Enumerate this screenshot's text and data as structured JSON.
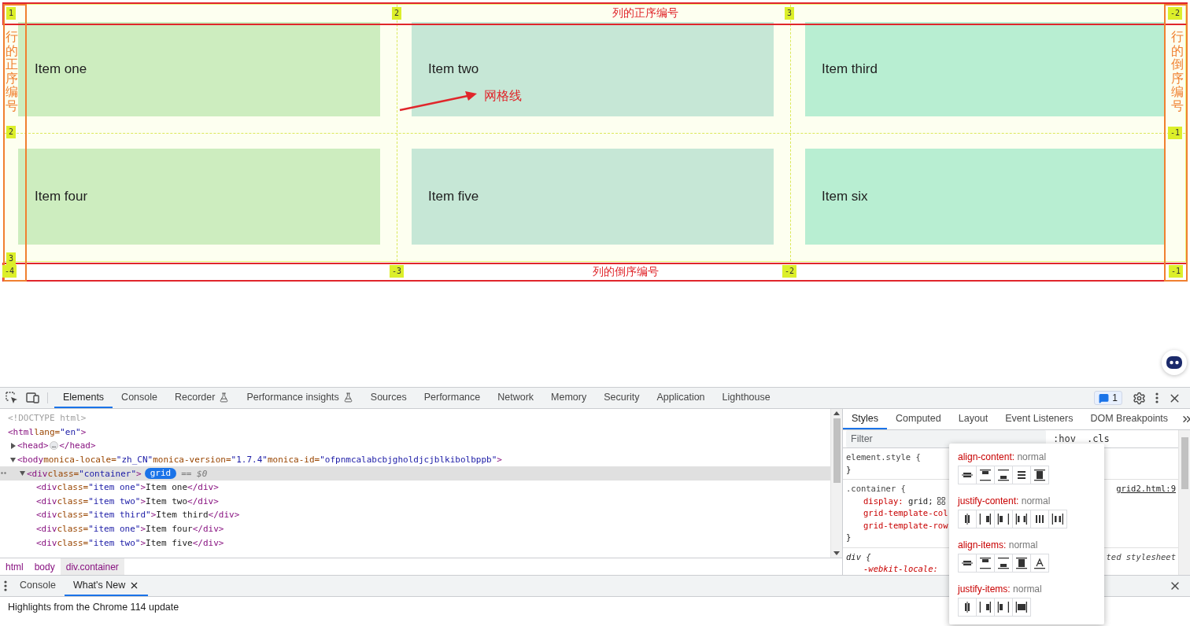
{
  "grid_demo": {
    "items": [
      {
        "label": "Item one",
        "color": "#cdedbf"
      },
      {
        "label": "Item two",
        "color": "#c6e7d6"
      },
      {
        "label": "Item third",
        "color": "#b8eed2"
      },
      {
        "label": "Item four",
        "color": "#cdedbf"
      },
      {
        "label": "Item five",
        "color": "#c6e7d6"
      },
      {
        "label": "Item six",
        "color": "#b8eed2"
      }
    ],
    "top_line_numbers": [
      "1",
      "2",
      "3",
      "-2"
    ],
    "left_line_numbers": [
      "2",
      "3"
    ],
    "right_line_numbers": [
      "-1"
    ],
    "bottom_line_numbers": [
      "-4",
      "-3",
      "-2",
      "-1"
    ],
    "labels": {
      "column_forward": "列的正序编号",
      "column_reverse": "列的倒序编号",
      "row_forward": "行的正序编号",
      "row_reverse": "行的倒序编号",
      "grid_line": "网格线"
    }
  },
  "devtools": {
    "toolbar_tabs": [
      {
        "label": "Elements",
        "selected": true
      },
      {
        "label": "Console",
        "selected": false
      },
      {
        "label": "Recorder",
        "selected": false,
        "experimental": true
      },
      {
        "label": "Performance insights",
        "selected": false,
        "experimental": true
      },
      {
        "label": "Sources",
        "selected": false
      },
      {
        "label": "Performance",
        "selected": false
      },
      {
        "label": "Network",
        "selected": false
      },
      {
        "label": "Memory",
        "selected": false
      },
      {
        "label": "Security",
        "selected": false
      },
      {
        "label": "Application",
        "selected": false
      },
      {
        "label": "Lighthouse",
        "selected": false
      }
    ],
    "issues_count": "1",
    "dom_tree": [
      {
        "segments": [
          {
            "kind": "doctype",
            "text": "<!DOCTYPE html>"
          }
        ],
        "selected": false
      },
      {
        "segments": [
          {
            "kind": "tag",
            "text": "<html"
          },
          {
            "kind": "attr",
            "text": " lang="
          },
          {
            "kind": "value",
            "text": "\"en\""
          },
          {
            "kind": "tag",
            "text": ">"
          }
        ],
        "selected": false,
        "children": [
          {
            "segments": [
              {
                "kind": "tag",
                "text": "<head>"
              },
              {
                "kind": "more",
                "text": "…"
              },
              {
                "kind": "tag",
                "text": "</head>"
              }
            ],
            "expanded": false,
            "selected": false
          },
          {
            "segments": [
              {
                "kind": "tag",
                "text": "<body"
              },
              {
                "kind": "attr",
                "text": " monica-locale="
              },
              {
                "kind": "value",
                "text": "\"zh_CN\""
              },
              {
                "kind": "attr",
                "text": " monica-version="
              },
              {
                "kind": "value",
                "text": "\"1.7.4\""
              },
              {
                "kind": "attr",
                "text": " monica-id="
              },
              {
                "kind": "value",
                "text": "\"ofpnmcalabcbjgholdjcjblkibolbppb\""
              },
              {
                "kind": "tag",
                "text": ">"
              }
            ],
            "expanded": true,
            "selected": false,
            "children": [
              {
                "segments": [
                  {
                    "kind": "tag",
                    "text": "<div"
                  },
                  {
                    "kind": "attr",
                    "text": " class="
                  },
                  {
                    "kind": "value",
                    "text": "\"container\""
                  },
                  {
                    "kind": "tag",
                    "text": ">"
                  },
                  {
                    "kind": "badge",
                    "text": "grid"
                  },
                  {
                    "kind": "ref",
                    "text": "== $0"
                  }
                ],
                "expanded": true,
                "selected": true,
                "children": [
                  {
                    "segments": [
                      {
                        "kind": "tag",
                        "text": "<div"
                      },
                      {
                        "kind": "attr",
                        "text": " class="
                      },
                      {
                        "kind": "value",
                        "text": "\"item one\""
                      },
                      {
                        "kind": "tag",
                        "text": ">"
                      },
                      {
                        "kind": "text",
                        "text": "Item one"
                      },
                      {
                        "kind": "tag",
                        "text": "</div>"
                      }
                    ],
                    "selected": false
                  },
                  {
                    "segments": [
                      {
                        "kind": "tag",
                        "text": "<div"
                      },
                      {
                        "kind": "attr",
                        "text": " class="
                      },
                      {
                        "kind": "value",
                        "text": "\"item two\""
                      },
                      {
                        "kind": "tag",
                        "text": ">"
                      },
                      {
                        "kind": "text",
                        "text": "Item two"
                      },
                      {
                        "kind": "tag",
                        "text": "</div>"
                      }
                    ],
                    "selected": false
                  },
                  {
                    "segments": [
                      {
                        "kind": "tag",
                        "text": "<div"
                      },
                      {
                        "kind": "attr",
                        "text": " class="
                      },
                      {
                        "kind": "value",
                        "text": "\"item third\""
                      },
                      {
                        "kind": "tag",
                        "text": ">"
                      },
                      {
                        "kind": "text",
                        "text": "Item third"
                      },
                      {
                        "kind": "tag",
                        "text": "</div>"
                      }
                    ],
                    "selected": false
                  },
                  {
                    "segments": [
                      {
                        "kind": "tag",
                        "text": "<div"
                      },
                      {
                        "kind": "attr",
                        "text": " class="
                      },
                      {
                        "kind": "value",
                        "text": "\"item one\""
                      },
                      {
                        "kind": "tag",
                        "text": ">"
                      },
                      {
                        "kind": "text",
                        "text": "Item four"
                      },
                      {
                        "kind": "tag",
                        "text": "</div>"
                      }
                    ],
                    "selected": false
                  },
                  {
                    "segments": [
                      {
                        "kind": "tag",
                        "text": "<div"
                      },
                      {
                        "kind": "attr",
                        "text": " class="
                      },
                      {
                        "kind": "value",
                        "text": "\"item two\""
                      },
                      {
                        "kind": "tag",
                        "text": ">"
                      },
                      {
                        "kind": "text",
                        "text": "Item five"
                      },
                      {
                        "kind": "tag",
                        "text": "</div>"
                      }
                    ],
                    "selected": false
                  }
                ]
              }
            ]
          }
        ]
      }
    ],
    "breadcrumbs": [
      {
        "label": "html",
        "selected": false
      },
      {
        "label": "body",
        "selected": false
      },
      {
        "label": "div.container",
        "selected": true
      }
    ],
    "sidebar_tabs": [
      {
        "label": "Styles",
        "selected": true
      },
      {
        "label": "Computed",
        "selected": false
      },
      {
        "label": "Layout",
        "selected": false
      },
      {
        "label": "Event Listeners",
        "selected": false
      },
      {
        "label": "DOM Breakpoints",
        "selected": false
      }
    ],
    "filter": {
      "placeholder": "Filter"
    },
    "filter_buttons": [
      ":hov",
      ".cls"
    ],
    "rules": [
      {
        "selector": "element.style",
        "open": "{",
        "close": "}"
      },
      {
        "selector": ".container",
        "open": "{",
        "close": "}",
        "source": "grid2.html:9",
        "declarations": [
          {
            "property": "display:",
            "value": "grid;",
            "grid_editor": true
          },
          {
            "property": "grid-template-col"
          },
          {
            "property": "grid-template-row"
          }
        ]
      },
      {
        "selector": "div",
        "open": "{",
        "user_agent": true,
        "source": "ted stylesheet",
        "declarations": [
          {
            "property": "-webkit-locale:"
          }
        ]
      }
    ],
    "grid_editor": [
      {
        "property": "align-content:",
        "value": "normal",
        "kind": "block",
        "options": [
          {
            "kind": "center"
          },
          {
            "kind": "start"
          },
          {
            "kind": "end"
          },
          {
            "kind": "space-around"
          },
          {
            "kind": "stretch"
          }
        ]
      },
      {
        "property": "justify-content:",
        "value": "normal",
        "kind": "inline",
        "options": [
          {
            "kind": "center"
          },
          {
            "kind": "start"
          },
          {
            "kind": "end"
          },
          {
            "kind": "space-between"
          },
          {
            "kind": "space-around"
          },
          {
            "kind": "space-evenly"
          }
        ]
      },
      {
        "property": "align-items:",
        "value": "normal",
        "kind": "block",
        "options": [
          {
            "kind": "center"
          },
          {
            "kind": "start"
          },
          {
            "kind": "end"
          },
          {
            "kind": "stretch"
          },
          {
            "kind": "baseline"
          }
        ]
      },
      {
        "property": "justify-items:",
        "value": "normal",
        "kind": "inline",
        "options": [
          {
            "kind": "center"
          },
          {
            "kind": "start"
          },
          {
            "kind": "end"
          },
          {
            "kind": "stretch"
          }
        ]
      }
    ],
    "drawer_tabs": [
      {
        "label": "Console",
        "selected": false
      },
      {
        "label": "What's New",
        "selected": true,
        "closable": true
      }
    ],
    "message": "Highlights from the Chrome 114 update"
  }
}
